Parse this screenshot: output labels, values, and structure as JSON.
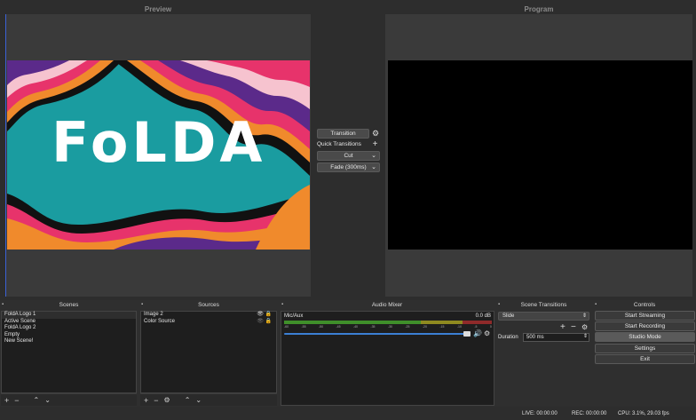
{
  "preview": {
    "title": "Preview",
    "logo_text": "FoLDA"
  },
  "program": {
    "title": "Program"
  },
  "transition_panel": {
    "transition_label": "Transition",
    "quick_transitions_label": "Quick Transitions",
    "cut_label": "Cut",
    "fade_label": "Fade (300ms)"
  },
  "docks": {
    "scenes": {
      "title": "Scenes",
      "items": [
        "FoldA Logo 1",
        "Active Scene",
        "FoldA Logo 2",
        "Empty",
        "New Scene!"
      ]
    },
    "sources": {
      "title": "Sources",
      "items": [
        "Image 2",
        "Color Source"
      ]
    },
    "audio_mixer": {
      "title": "Audio Mixer",
      "channel_name": "Mic/Aux",
      "db_value": "0.0 dB",
      "scale": [
        "-60",
        "-55",
        "-50",
        "-45",
        "-40",
        "-35",
        "-30",
        "-25",
        "-20",
        "-15",
        "-10",
        "-5",
        "0"
      ]
    },
    "scene_transitions": {
      "title": "Scene Transitions",
      "selected": "Slide",
      "duration_label": "Duration",
      "duration_value": "500 ms"
    },
    "controls": {
      "title": "Controls",
      "buttons": [
        "Start Streaming",
        "Start Recording",
        "Studio Mode",
        "Settings",
        "Exit"
      ]
    }
  },
  "status_bar": {
    "live": "LIVE: 00:00:00",
    "rec": "REC: 00:00:00",
    "cpu": "CPU: 3.1%, 29.03 fps"
  },
  "colors": {
    "background": "#2d2d2d",
    "preview_teal": "#1a9ca0",
    "meter_green": "#3f8f2a",
    "meter_yellow": "#8f8a20",
    "meter_red": "#8f2a2a",
    "slider_blue": "#3b7fd4"
  }
}
